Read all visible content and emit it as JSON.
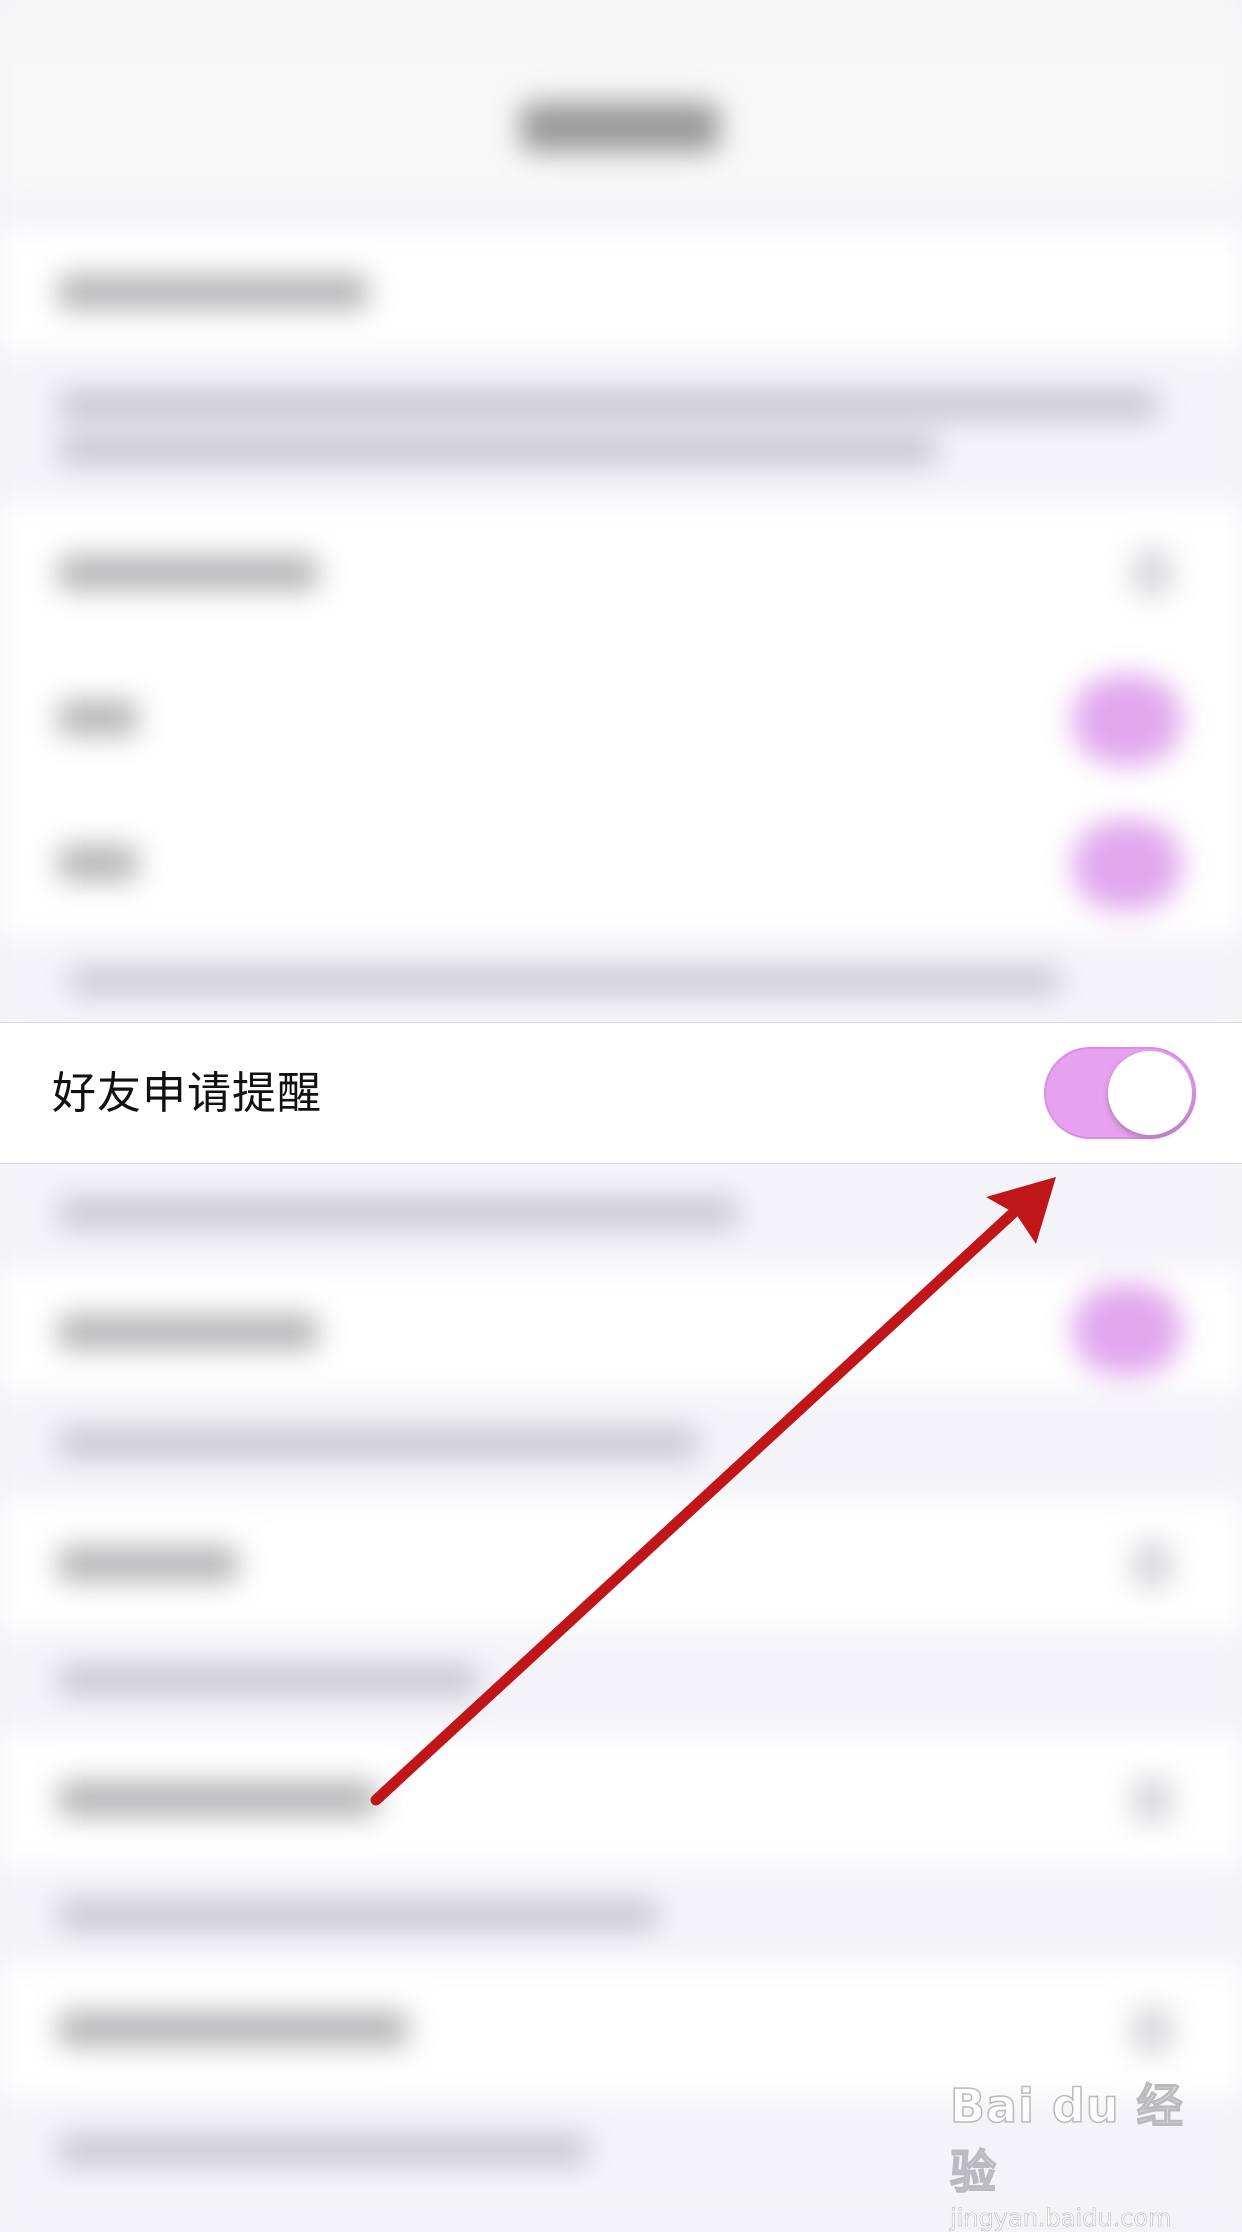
{
  "setting_row": {
    "label": "好友申请提醒",
    "toggle_on": true
  },
  "colors": {
    "toggle_track": "#e6a2ef",
    "toggle_knob": "#ffffff",
    "arrow": "#c0161a",
    "background": "#f4f3f7"
  },
  "icons": {
    "toggle": "toggle-switch-icon",
    "annotation": "red-arrow-icon"
  },
  "watermark": {
    "logo": "Bai du 经验",
    "url": "jingyan.baidu.com"
  }
}
